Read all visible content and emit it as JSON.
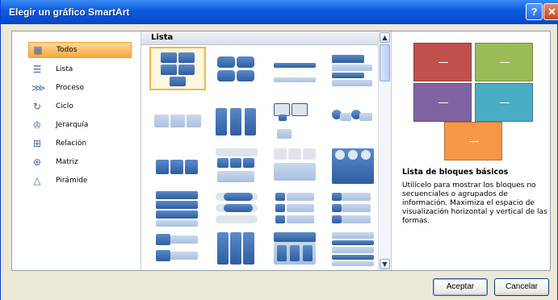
{
  "window": {
    "title": "Elegir un gráfico SmartArt",
    "help_label": "?",
    "close_label": "✕"
  },
  "categories": [
    {
      "label": "Todos",
      "icon": "all-icon",
      "selected": true
    },
    {
      "label": "Lista",
      "icon": "list-icon"
    },
    {
      "label": "Proceso",
      "icon": "process-icon"
    },
    {
      "label": "Ciclo",
      "icon": "cycle-icon"
    },
    {
      "label": "Jerarquía",
      "icon": "hierarchy-icon"
    },
    {
      "label": "Relación",
      "icon": "relationship-icon"
    },
    {
      "label": "Matriz",
      "icon": "matrix-icon"
    },
    {
      "label": "Pirámide",
      "icon": "pyramid-icon"
    }
  ],
  "gallery": {
    "header": "Lista",
    "scroll_up": "▲",
    "scroll_down": "▼"
  },
  "preview": {
    "title": "Lista de bloques básicos",
    "description": "Utilícelo para mostrar los bloques no secuenciales o agrupados de información. Maximiza el espacio de visualización horizontal y vertical de las formas.",
    "colors": [
      "#c0504d",
      "#9bbb59",
      "#8064a2",
      "#4bacc6",
      "#f79646"
    ]
  },
  "buttons": {
    "ok": "Aceptar",
    "cancel": "Cancelar"
  }
}
